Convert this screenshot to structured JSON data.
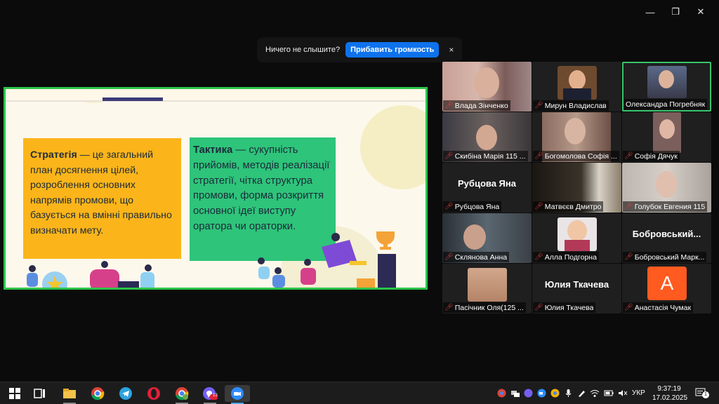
{
  "window": {
    "minimize": "—",
    "maximize": "❐",
    "close": "✕"
  },
  "notification": {
    "message": "Ничего не слышите?",
    "action": "Прибавить громкость",
    "close": "×"
  },
  "slide": {
    "strategy_head": "Стратегія",
    "strategy_text": " — це загальний план досягнення цілей, розроблення основних напрямів промови, що базується на вмінні правильно визначати мету.",
    "tactic_head": "Тактика",
    "tactic_text": " — сукупність прийомів, методів реалізації стратегії, чітка структура промови, форма розкриття основної ідеї виступу оратора чи ораторки."
  },
  "participants": [
    {
      "name": "Влада Зінченко",
      "video": true,
      "muted": true
    },
    {
      "name": "Мирун Владислав",
      "video": true,
      "muted": true
    },
    {
      "name": "Олександра Погребняк",
      "video": true,
      "muted": false,
      "active": true
    },
    {
      "name": "Скибіна Марія 115 ...",
      "video": true,
      "muted": true
    },
    {
      "name": "Богомолова Софія ...",
      "video": true,
      "muted": true
    },
    {
      "name": "Софія Дячук",
      "video": true,
      "muted": true
    },
    {
      "name": "Рубцова Яна",
      "video": false,
      "big": "Рубцова Яна",
      "muted": true
    },
    {
      "name": "Матвєєв Дмитро",
      "video": true,
      "muted": true
    },
    {
      "name": "Голубок Евгения 115",
      "video": true,
      "muted": true
    },
    {
      "name": "Склянова Анна",
      "video": true,
      "muted": true
    },
    {
      "name": "Алла Подгорна",
      "video": true,
      "muted": true
    },
    {
      "name": "Бобровський Марк...",
      "video": false,
      "big": "Бобровський...",
      "muted": true
    },
    {
      "name": "Пасічник Оля(125 ...",
      "video": true,
      "muted": true
    },
    {
      "name": "Юлия Ткачева",
      "video": false,
      "big": "Юлия Ткачева",
      "muted": true
    },
    {
      "name": "Анастасія Чумак",
      "video": false,
      "avatar": "A",
      "muted": true
    }
  ],
  "taskbar": {
    "apps": [
      "windows-start",
      "task-view",
      "file-explorer",
      "chrome",
      "telegram",
      "opera",
      "chrome-profile",
      "viber",
      "zoom"
    ],
    "viber_badge": "13",
    "language": "УКР",
    "time": "9:37:19",
    "date": "17.02.2025",
    "notifications": "1"
  }
}
